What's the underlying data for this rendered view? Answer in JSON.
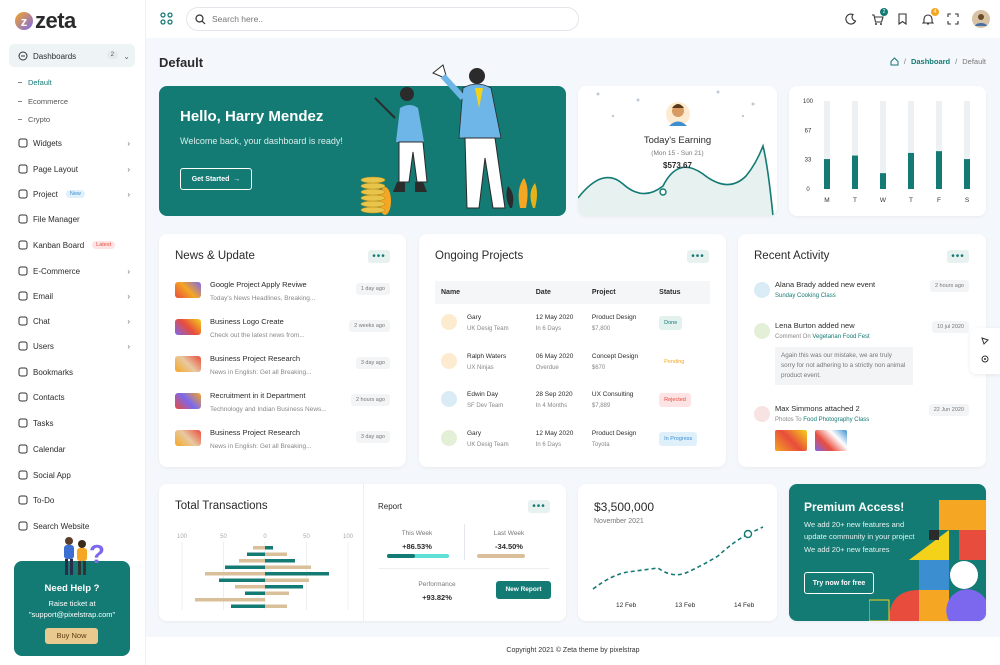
{
  "logo": {
    "text": "zeta",
    "mark": "z"
  },
  "search": {
    "placeholder": "Search here.."
  },
  "topbar": {
    "cart_badge": "2",
    "bell_badge": "4"
  },
  "sidebar": {
    "dashboards": {
      "label": "Dashboards",
      "count": "2"
    },
    "sub": [
      "Default",
      "Ecommerce",
      "Crypto"
    ],
    "items": [
      {
        "label": "Widgets"
      },
      {
        "label": "Page Layout"
      },
      {
        "label": "Project",
        "badge": "New"
      },
      {
        "label": "File Manager"
      },
      {
        "label": "Kanban Board",
        "badge": "Latest"
      },
      {
        "label": "E-Commerce"
      },
      {
        "label": "Email"
      },
      {
        "label": "Chat"
      },
      {
        "label": "Users"
      },
      {
        "label": "Bookmarks"
      },
      {
        "label": "Contacts"
      },
      {
        "label": "Tasks"
      },
      {
        "label": "Calendar"
      },
      {
        "label": "Social App"
      },
      {
        "label": "To-Do"
      },
      {
        "label": "Search Website"
      }
    ],
    "help": {
      "title": "Need Help ?",
      "line1": "Raise ticket at",
      "line2": "\"support@pixelstrap.com\"",
      "button": "Buy Now"
    }
  },
  "page": {
    "title": "Default",
    "crumb_home": "Dashboard",
    "crumb_current": "Default"
  },
  "hello": {
    "title": "Hello, Harry Mendez",
    "subtitle": "Welcome back, your dashboard is ready!",
    "button": "Get Started"
  },
  "earning": {
    "title": "Today's Earning",
    "range": "(Mon 15 - Sun 21)",
    "amount": "$573.67"
  },
  "colors": {
    "teal": "#147a74",
    "orange": "#f5a623",
    "dark": "#2b2b2b"
  },
  "chart_data": [
    {
      "type": "bar",
      "categories": [
        "M",
        "T",
        "W",
        "T",
        "F",
        "S"
      ],
      "values": [
        34,
        38,
        18,
        41,
        43,
        34
      ],
      "ylim": [
        0,
        100
      ],
      "yticks": [
        "100",
        "67",
        "33",
        "0"
      ]
    },
    {
      "type": "line",
      "title": "$3,500,000",
      "subtitle": "November 2021",
      "categories": [
        "12 Feb",
        "13 Feb",
        "14 Feb"
      ]
    }
  ],
  "news": {
    "title": "News & Update",
    "items": [
      {
        "title": "Google Project Apply Reviwe",
        "sub": "Today's News Headlines, Breaking...",
        "time": "1 day ago"
      },
      {
        "title": "Business Logo Create",
        "sub": "Check out the latest news from...",
        "time": "2 weeks ago"
      },
      {
        "title": "Business Project Research",
        "sub": "News in English: Get all Breaking...",
        "time": "3 day ago"
      },
      {
        "title": "Recruitment in it Department",
        "sub": "Technology and Indian Business News...",
        "time": "2 hours ago"
      },
      {
        "title": "Business Project Research",
        "sub": "News in English: Get all Breaking...",
        "time": "3 day ago"
      }
    ]
  },
  "projects": {
    "title": "Ongoing Projects",
    "headers": [
      "Name",
      "Date",
      "Project",
      "Status"
    ],
    "rows": [
      {
        "name": "Gary",
        "team": "UK Desig Team",
        "date": "12 May 2020",
        "dur": "In 6 Days",
        "proj": "Product Design",
        "val": "$7,800",
        "status": "Done"
      },
      {
        "name": "Ralph Waters",
        "team": "UX Ninjas",
        "date": "06 May 2020",
        "dur": "Overdue",
        "proj": "Concept Design",
        "val": "$670",
        "status": "Pending"
      },
      {
        "name": "Edwin Day",
        "team": "SF Dev Team",
        "date": "28 Sep 2020",
        "dur": "In 4 Months",
        "proj": "UX Consulting",
        "val": "$7,889",
        "status": "Rejected"
      },
      {
        "name": "Gary",
        "team": "UK Desig Team",
        "date": "12 May 2020",
        "dur": "In 6 Days",
        "proj": "Product Design",
        "val": "Toyota",
        "status": "In Progress"
      }
    ]
  },
  "activity": {
    "title": "Recent Activity",
    "items": [
      {
        "title": "Alana Brady added new event",
        "sub": "Sunday Cooking Class",
        "time": "2 hours ago"
      },
      {
        "title": "Lena Burton added new",
        "sub_prefix": "Comment On",
        "sub": "Vegetarian Food Fest",
        "time": "10 jul 2020",
        "comment": "Again this was our mistake, we are truly sorry for not adhering to a strictly non animal product event."
      },
      {
        "title": "Max Simmons attached 2",
        "sub_prefix": "Photos To",
        "sub": "Food Photography Class",
        "time": "22 Jun 2020"
      }
    ]
  },
  "transactions": {
    "title": "Total Transactions",
    "axis": [
      "100",
      "50",
      "0",
      "50",
      "100"
    ],
    "report": "Report",
    "this_week_label": "This Week",
    "this_week": "+86.53%",
    "last_week_label": "Last Week",
    "last_week": "-34.50%",
    "perf_label": "Performance",
    "perf": "+93.82%",
    "button": "New Report"
  },
  "premium": {
    "title": "Premium Access!",
    "line1": "We add 20+ new features and",
    "line2": "update community in your project",
    "line3": "We add 20+ new features",
    "button": "Try now for free"
  },
  "footer": "Copyright 2021 © Zeta theme by pixelstrap"
}
